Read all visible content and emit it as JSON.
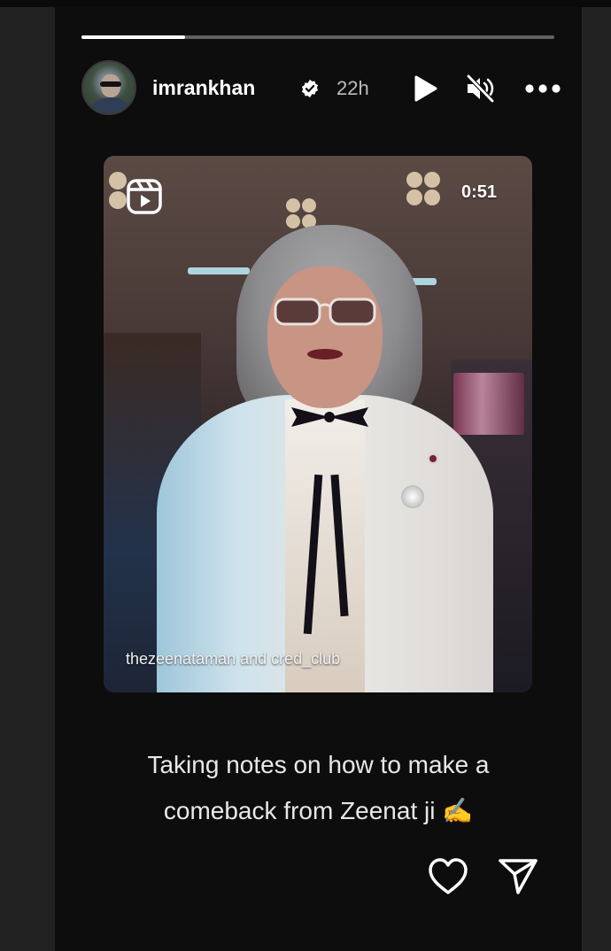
{
  "story": {
    "progress_fraction": 0.22,
    "user": {
      "username": "imrankhan",
      "verified": true,
      "time_ago": "22h"
    },
    "controls": {
      "play_icon": "play-icon",
      "mute_icon": "speaker-muted-icon",
      "more_icon": "more-horizontal-icon"
    },
    "shared_reel": {
      "badge_icon": "reels-icon",
      "duration": "0:51",
      "credit": "thezeenataman and cred_club"
    },
    "caption": {
      "line1": "Taking notes on how to make a",
      "line2": "comeback from Zeenat ji ✍️"
    },
    "actions": {
      "like_icon": "heart-icon",
      "share_icon": "send-icon"
    }
  },
  "colors": {
    "background": "#0d0d0d",
    "text": "#ffffff",
    "muted_text": "#bdbdbd"
  }
}
